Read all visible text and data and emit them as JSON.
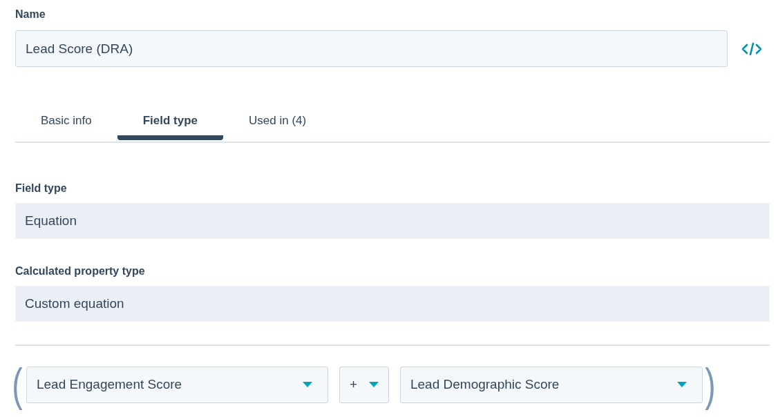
{
  "name_field": {
    "label": "Name",
    "value": "Lead Score (DRA)"
  },
  "tabs": [
    {
      "label": "Basic info",
      "selected": false
    },
    {
      "label": "Field type",
      "selected": true
    },
    {
      "label": "Used in (4)",
      "selected": false
    }
  ],
  "field_type": {
    "label": "Field type",
    "value": "Equation"
  },
  "calculated_property_type": {
    "label": "Calculated property type",
    "value": "Custom equation"
  },
  "equation": {
    "open_paren": "(",
    "left_operand": "Lead Engagement Score",
    "operator": "+",
    "right_operand": "Lead Demographic Score",
    "close_paren": ")"
  }
}
